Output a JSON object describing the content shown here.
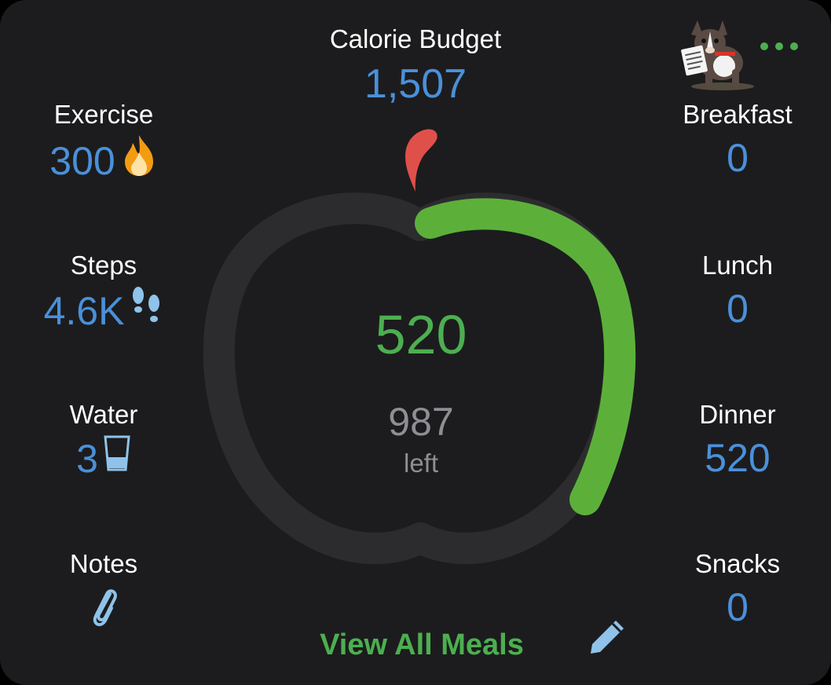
{
  "budget": {
    "label": "Calorie Budget",
    "value": "1,507"
  },
  "left_stats": [
    {
      "label": "Exercise",
      "value": "300",
      "icon": "flame-icon"
    },
    {
      "label": "Steps",
      "value": "4.6K",
      "icon": "footprints-icon"
    },
    {
      "label": "Water",
      "value": "3",
      "icon": "glass-icon"
    },
    {
      "label": "Notes",
      "value": "",
      "icon": "paperclip-icon"
    }
  ],
  "meals": [
    {
      "label": "Breakfast",
      "value": "0"
    },
    {
      "label": "Lunch",
      "value": "0"
    },
    {
      "label": "Dinner",
      "value": "520"
    },
    {
      "label": "Snacks",
      "value": "0"
    }
  ],
  "ring": {
    "consumed": "520",
    "remaining": "987",
    "remaining_label": "left",
    "progress_fraction": 0.345
  },
  "view_all_label": "View All Meals",
  "colors": {
    "background": "#1c1c1e",
    "accent_green": "#4caf50",
    "value_blue": "#4a90d9",
    "ring_track": "#2c2c2e",
    "stem_red": "#e0504a",
    "icon_blue": "#8fc3ea",
    "muted_gray": "#8e8e93"
  }
}
